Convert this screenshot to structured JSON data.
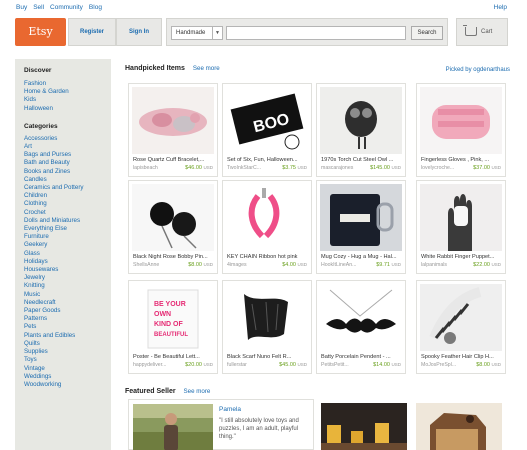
{
  "topnav": {
    "links": [
      "Buy",
      "Sell",
      "Community",
      "Blog"
    ],
    "help": "Help"
  },
  "header": {
    "logo": "Etsy",
    "register": "Register",
    "sign_in": "Sign In",
    "search": {
      "category": "Handmade",
      "query": "",
      "button": "Search"
    },
    "cart": "Cart"
  },
  "sidebar": {
    "discover_title": "Discover",
    "discover": [
      "Fashion",
      "Home & Garden",
      "Kids",
      "Halloween"
    ],
    "categories_title": "Categories",
    "categories": [
      "Accessories",
      "Art",
      "Bags and Purses",
      "Bath and Beauty",
      "Books and Zines",
      "Candles",
      "Ceramics and Pottery",
      "Children",
      "Clothing",
      "Crochet",
      "Dolls and Miniatures",
      "Everything Else",
      "Furniture",
      "Geekery",
      "Glass",
      "Holidays",
      "Housewares",
      "Jewelry",
      "Knitting",
      "Music",
      "Needlecraft",
      "Paper Goods",
      "Patterns",
      "Pets",
      "Plants and Edibles",
      "Quilts",
      "Supplies",
      "Toys",
      "Vintage",
      "Weddings",
      "Woodworking"
    ]
  },
  "handpicked": {
    "title": "Handpicked Items",
    "see_more": "See more",
    "picked_by": "Picked by ogdenarthaus",
    "items": [
      {
        "title": "Rose Quartz Cuff Bracelet,...",
        "shop": "lapisbeach",
        "price": "$46.00",
        "currency": "USD"
      },
      {
        "title": "Set of Six, Fun, Halloween...",
        "shop": "TwoInkStarC...",
        "price": "$3.75",
        "currency": "USD"
      },
      {
        "title": "1970s Torch Cut Steel Owl ...",
        "shop": "mascarajones",
        "price": "$145.00",
        "currency": "USD"
      },
      {
        "title": "Fingerless Gloves , Pink, ...",
        "shop": "lovelycroche...",
        "price": "$37.00",
        "currency": "USD"
      },
      {
        "title": "Black Night Rose Bobby Pin...",
        "shop": "ShellsAnne",
        "price": "$8.00",
        "currency": "USD"
      },
      {
        "title": "KEY CHAIN Ribbon hot pink",
        "shop": "4images",
        "price": "$4.00",
        "currency": "USD"
      },
      {
        "title": "Mug Cozy - Hug a Mug - Hal...",
        "shop": "HookItLineAn...",
        "price": "$9.71",
        "currency": "USD"
      },
      {
        "title": "White Rabbit Finger Puppet...",
        "shop": "lalpanimals",
        "price": "$22.00",
        "currency": "USD"
      },
      {
        "title": "Poster - Be Beautiful Lett...",
        "shop": "happydeliver...",
        "price": "$20.00",
        "currency": "USD"
      },
      {
        "title": "Black Scarf Nuno Felt R...",
        "shop": "fullerstar",
        "price": "$45.00",
        "currency": "USD"
      },
      {
        "title": "Batty Porcelain Pendent - ...",
        "shop": "PetitsPetit...",
        "price": "$14.00",
        "currency": "USD"
      },
      {
        "title": "Spooky Feather Hair Clip H...",
        "shop": "MoJosPreSpl...",
        "price": "$8.00",
        "currency": "USD"
      }
    ]
  },
  "featured": {
    "title": "Featured Seller",
    "see_more": "See more",
    "seller_name": "Pamela",
    "quote": "\"I still absolutely love toys and puzzles, I am an adult, playful thing.\""
  },
  "poster_text": "BE YOUR OWN KIND OF BEAUTIFUL"
}
